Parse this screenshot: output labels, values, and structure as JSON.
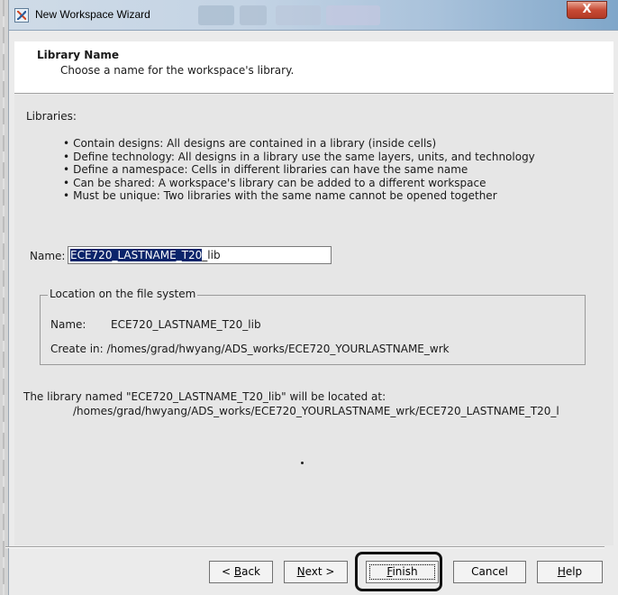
{
  "window": {
    "title": "New Workspace Wizard",
    "close_glyph": "X"
  },
  "header": {
    "title": "Library Name",
    "subtitle": "Choose a name for the workspace's library."
  },
  "libraries": {
    "heading": "Libraries:",
    "bullets": [
      "Contain designs: All designs are contained in a library (inside cells)",
      "Define technology: All designs in a library use the same layers, units, and technology",
      "Define a namespace: Cells in different libraries can have the same name",
      "Can be shared: A workspace's library can be added to a different workspace",
      "Must be unique: Two libraries with the same name cannot be opened together"
    ]
  },
  "name_field": {
    "label": "Name:",
    "value_selected": "ECE720_LASTNAME_T20",
    "value_rest": "_lib"
  },
  "location": {
    "legend": "Location on the file system",
    "name_label": "Name:",
    "name_value": "ECE720_LASTNAME_T20_lib",
    "create_in": "Create in: /homes/grad/hwyang/ADS_works/ECE720_YOURLASTNAME_wrk"
  },
  "summary": {
    "line1": "The library named \"ECE720_LASTNAME_T20_lib\" will be located at:",
    "line2": "/homes/grad/hwyang/ADS_works/ECE720_YOURLASTNAME_wrk/ECE720_LASTNAME_T20_l"
  },
  "buttons": {
    "back": {
      "prefix": "< ",
      "mnemonic": "B",
      "rest": "ack"
    },
    "next": {
      "mnemonic": "N",
      "rest": "ext >"
    },
    "finish": {
      "mnemonic": "F",
      "rest": "inish"
    },
    "cancel": {
      "label": "Cancel"
    },
    "help": {
      "mnemonic": "H",
      "rest": "elp"
    }
  }
}
